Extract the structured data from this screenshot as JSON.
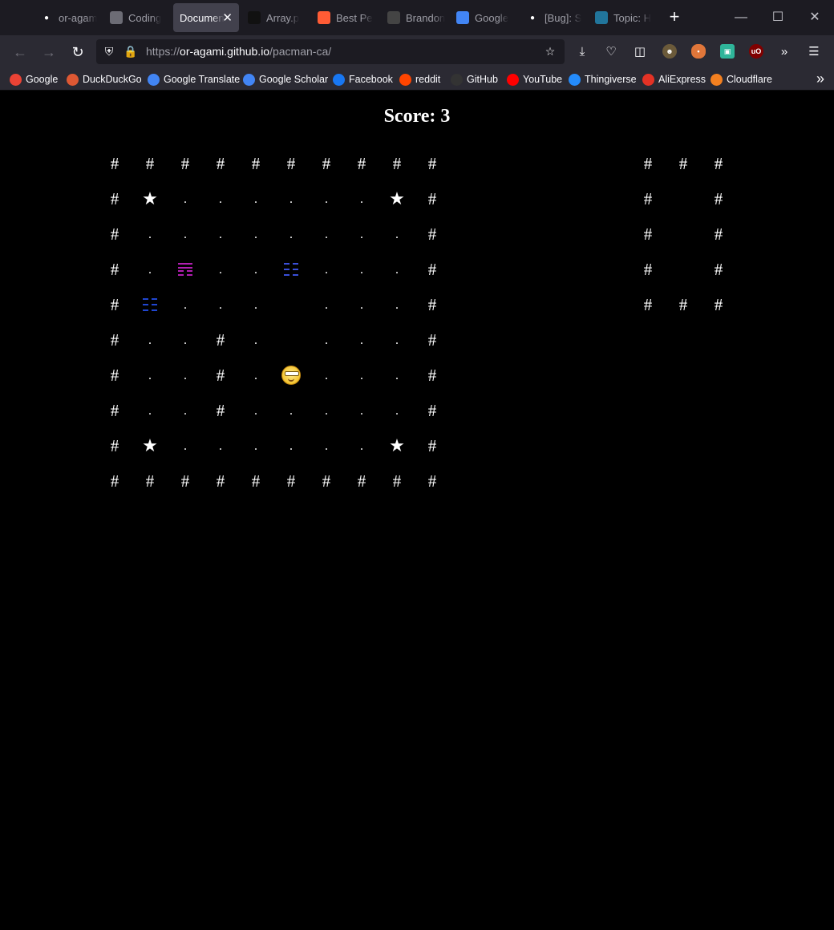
{
  "browser": {
    "tabs": [
      {
        "label": "or-agam",
        "icon": "github-icon",
        "color": "#ffffff",
        "active": false
      },
      {
        "label": "Coding",
        "icon": "terminal-icon",
        "color": "#6c6c75",
        "active": false
      },
      {
        "label": "Documen",
        "icon": "",
        "color": "",
        "active": true
      },
      {
        "label": "Array.p",
        "icon": "medium-icon",
        "color": "#111111",
        "active": false
      },
      {
        "label": "Best Pe",
        "icon": "hubspot-icon",
        "color": "#ff5c35",
        "active": false
      },
      {
        "label": "Brandon",
        "icon": "bookmark-icon",
        "color": "#444444",
        "active": false
      },
      {
        "label": "Google",
        "icon": "google-translate-icon",
        "color": "#4285f4",
        "active": false
      },
      {
        "label": "[Bug]: S",
        "icon": "github-icon",
        "color": "#ffffff",
        "active": false
      },
      {
        "label": "Topic: H",
        "icon": "wordpress-icon",
        "color": "#21759b",
        "active": false
      }
    ],
    "url": {
      "scheme": "https://",
      "host": "or-agami.github.io",
      "path": "/pacman-ca/"
    },
    "bookmarks": [
      {
        "label": "Google",
        "icon": "google-icon",
        "color": "#ea4335"
      },
      {
        "label": "DuckDuckGo",
        "icon": "duckduckgo-icon",
        "color": "#de5833"
      },
      {
        "label": "Google Translate",
        "icon": "google-translate-icon",
        "color": "#4285f4"
      },
      {
        "label": "Google Scholar",
        "icon": "google-scholar-icon",
        "color": "#4285f4"
      },
      {
        "label": "Facebook",
        "icon": "facebook-icon",
        "color": "#1877f2"
      },
      {
        "label": "reddit",
        "icon": "reddit-icon",
        "color": "#ff4500"
      },
      {
        "label": "GitHub",
        "icon": "github-icon",
        "color": "#333333"
      },
      {
        "label": "YouTube",
        "icon": "youtube-icon",
        "color": "#ff0000"
      },
      {
        "label": "Thingiverse",
        "icon": "thingiverse-icon",
        "color": "#248bfb"
      },
      {
        "label": "AliExpress",
        "icon": "aliexpress-icon",
        "color": "#e43225"
      },
      {
        "label": "Cloudflare",
        "icon": "cloudflare-icon",
        "color": "#f38020"
      }
    ]
  },
  "game": {
    "score_label": "Score: 3",
    "board": [
      "##########",
      "#*......*#",
      "#..........#",
      "#.M..B...#",
      "#G... ...#",
      "#..#. ...#",
      "#..#.P...#",
      "#..#.....#",
      "#*......*#",
      "##########"
    ],
    "side_board": [
      "###",
      "# #",
      "# #",
      "# #",
      "###"
    ],
    "symbols": {
      "wall": "#",
      "dot": ".",
      "power": "★"
    },
    "ghost_colors": {
      "M": "#b01fb0",
      "B": "#3a4fd8",
      "G": "#2046d0"
    }
  }
}
